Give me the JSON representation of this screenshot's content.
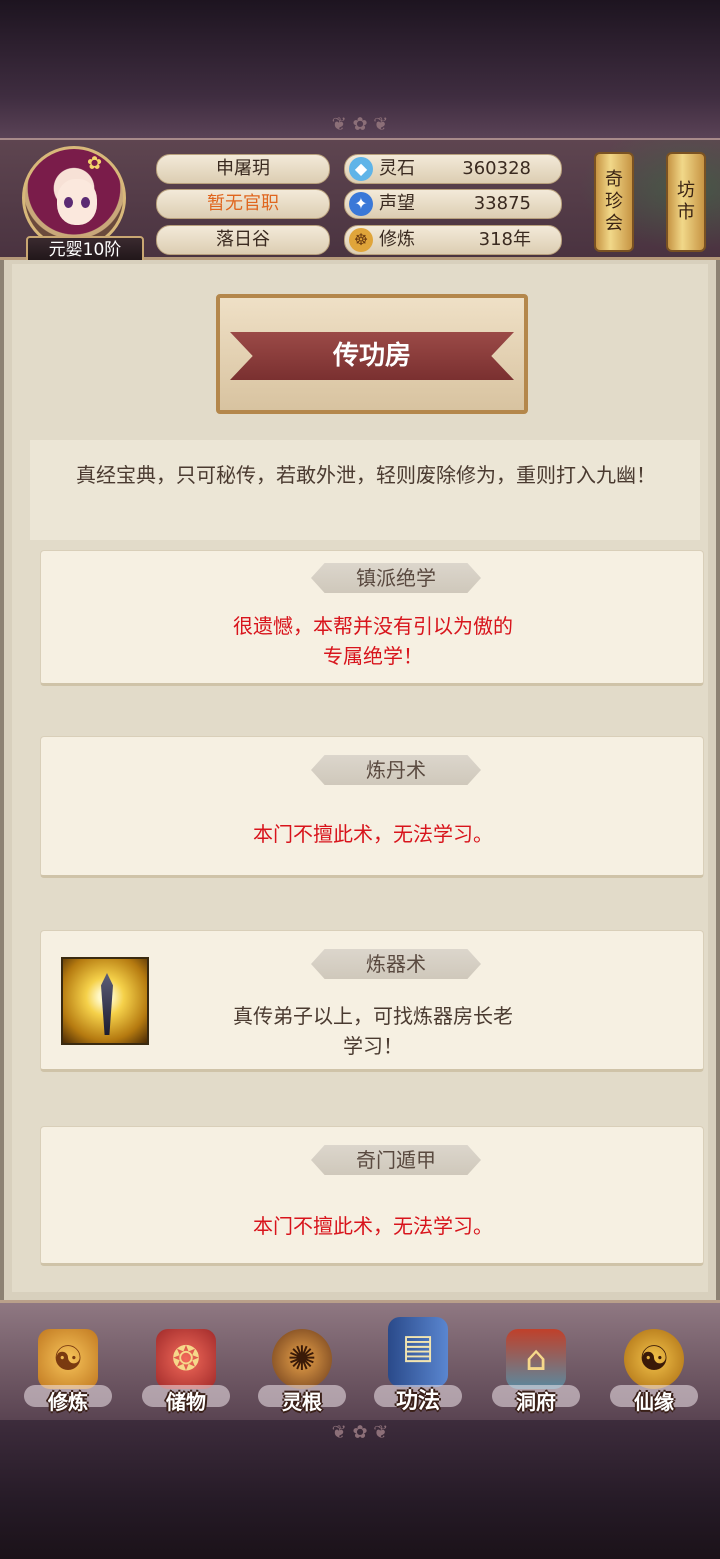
{
  "player": {
    "rank": "元婴10阶",
    "name": "申屠玥",
    "title": "暂无官职",
    "location": "落日谷"
  },
  "stats": [
    {
      "label": "灵石",
      "value": "360328",
      "icon": "spirit-stone-icon"
    },
    {
      "label": "声望",
      "value": "33875",
      "icon": "reputation-crystal-icon"
    },
    {
      "label": "修炼",
      "value": "318年",
      "icon": "meditation-icon"
    }
  ],
  "side_buttons": [
    {
      "chars": [
        "奇",
        "珍",
        "会"
      ]
    },
    {
      "chars": [
        "坊",
        "市"
      ]
    }
  ],
  "page": {
    "title": "传功房",
    "intro": "真经宝典，只可秘传，若敢外泄，轻则废除修为，重则打入九幽！"
  },
  "cards": [
    {
      "title": "镇派绝学",
      "text_lines": [
        "很遗憾，本帮并没有引以为傲的",
        "专属绝学！"
      ],
      "color": "#d8141c"
    },
    {
      "title": "炼丹术",
      "text_lines": [
        "本门不擅此术，无法学习。"
      ],
      "color": "#d8141c"
    },
    {
      "title": "炼器术",
      "text_lines": [
        "真传弟子以上，可找炼器房长老",
        "学习！"
      ],
      "color": "#4a3a30",
      "icon": "glowing-sword-icon"
    },
    {
      "title": "奇门遁甲",
      "text_lines": [
        "本门不擅此术，无法学习。"
      ],
      "color": "#d8141c"
    }
  ],
  "nav": [
    {
      "label": "修炼",
      "icon": "cultivate-monk-icon"
    },
    {
      "label": "储物",
      "icon": "storage-bag-icon"
    },
    {
      "label": "灵根",
      "icon": "spirit-root-icon"
    },
    {
      "label": "功法",
      "icon": "technique-book-icon",
      "active": true
    },
    {
      "label": "洞府",
      "icon": "cave-mansion-icon"
    },
    {
      "label": "仙缘",
      "icon": "immortal-gourd-icon"
    }
  ]
}
